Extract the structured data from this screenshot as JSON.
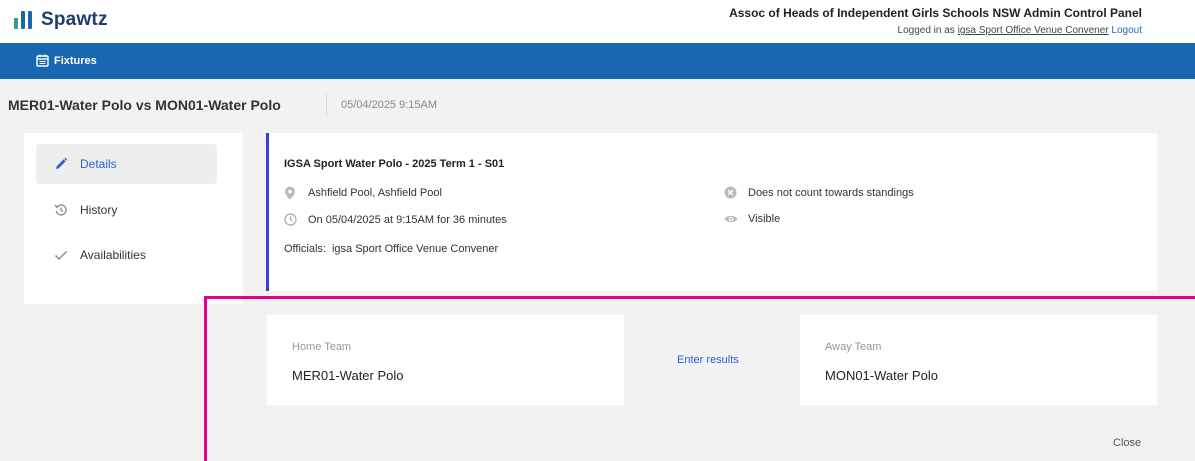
{
  "app": {
    "logo_text": "Spawtz",
    "org_title": "Assoc of Heads of Independent Girls Schools NSW Admin Control Panel",
    "logged_in_prefix": "Logged in as",
    "logged_in_user": "igsa Sport Office Venue Convener",
    "logout_label": "Logout"
  },
  "nav": {
    "fixtures_label": "Fixtures",
    "fixtures_icon": "calendar-icon"
  },
  "fixture": {
    "title": "MER01-Water Polo vs MON01-Water Polo",
    "datetime": "05/04/2025 9:15AM"
  },
  "side_menu": {
    "items": [
      {
        "label": "Details",
        "icon": "pencil-icon",
        "active": true
      },
      {
        "label": "History",
        "icon": "history-icon",
        "active": false
      },
      {
        "label": "Availabilities",
        "icon": "check-icon",
        "active": false
      }
    ]
  },
  "details": {
    "competition": "IGSA Sport Water Polo - 2025 Term 1 - S01",
    "venue": "Ashfield Pool, Ashfield Pool",
    "schedule": "On 05/04/2025 at 9:15AM for 36 minutes",
    "officials_label": "Officials:",
    "officials_value": "igsa Sport Office Venue Convener",
    "standings": "Does not count towards standings",
    "visibility": "Visible"
  },
  "teams": {
    "home_label": "Home Team",
    "home_name": "MER01-Water Polo",
    "away_label": "Away Team",
    "away_name": "MON01-Water Polo",
    "enter_results_label": "Enter results"
  },
  "actions": {
    "close_label": "Close"
  },
  "colors": {
    "brand_blue": "#1a67b1",
    "accent_link": "#2a5fd1",
    "card_accent": "#3a3fd4",
    "highlight": "#e5008c"
  }
}
